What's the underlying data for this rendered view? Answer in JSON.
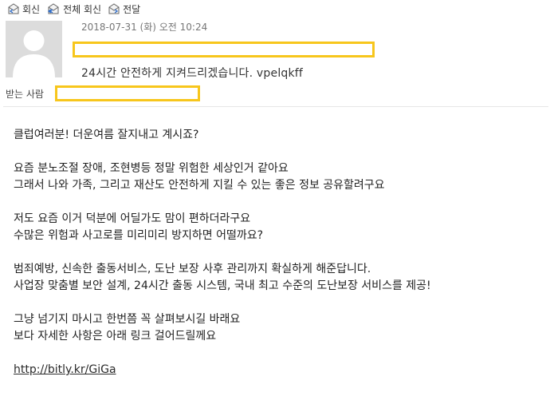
{
  "toolbar": {
    "reply_label": "회신",
    "reply_all_label": "전체 회신",
    "forward_label": "전달"
  },
  "header": {
    "date": "2018-07-31 (화) 오전 10:24",
    "subject": "24시간 안전하게 지켜드리겠습니다. vpelqkff",
    "recipient_label": "받는 사람"
  },
  "body": {
    "paragraphs": [
      [
        "클럽여러분! 더운여름 잘지내고 계시죠?"
      ],
      [
        "요즘 분노조절 장애, 조현병등 정말 위험한 세상인거 같아요",
        "그래서 나와 가족, 그리고 재산도 안전하게 지킬 수 있는 좋은 정보 공유할려구요"
      ],
      [
        "저도 요즘 이거  덕분에 어딜가도 맘이 편하더라구요",
        "수많은 위험과 사고로를 미리미리 방지하면 어떨까요?"
      ],
      [
        "범죄예방, 신속한 출동서비스, 도난 보장 사후 관리까지 확실하게 해준답니다.",
        "사업장 맞춤별 보안 설계, 24시간 출동 시스템, 국내 최고 수준의 도난보장 서비스를 제공!"
      ],
      [
        "그냥 넘기지 마시고 한번쯤 꼭 살펴보시길 바래요",
        "보다 자세한 사항은 아래  링크 걸어드릴께요"
      ]
    ],
    "link": "http://bitly.kr/GiGa"
  },
  "colors": {
    "highlight_box": "#f7c61c",
    "avatar_bg": "#dcdcdc",
    "avatar_silhouette": "#ffffff"
  },
  "icons": {
    "reply": "envelope-reply-icon",
    "reply_all": "envelope-reply-all-icon",
    "forward": "envelope-forward-icon",
    "avatar": "person-silhouette-icon"
  }
}
